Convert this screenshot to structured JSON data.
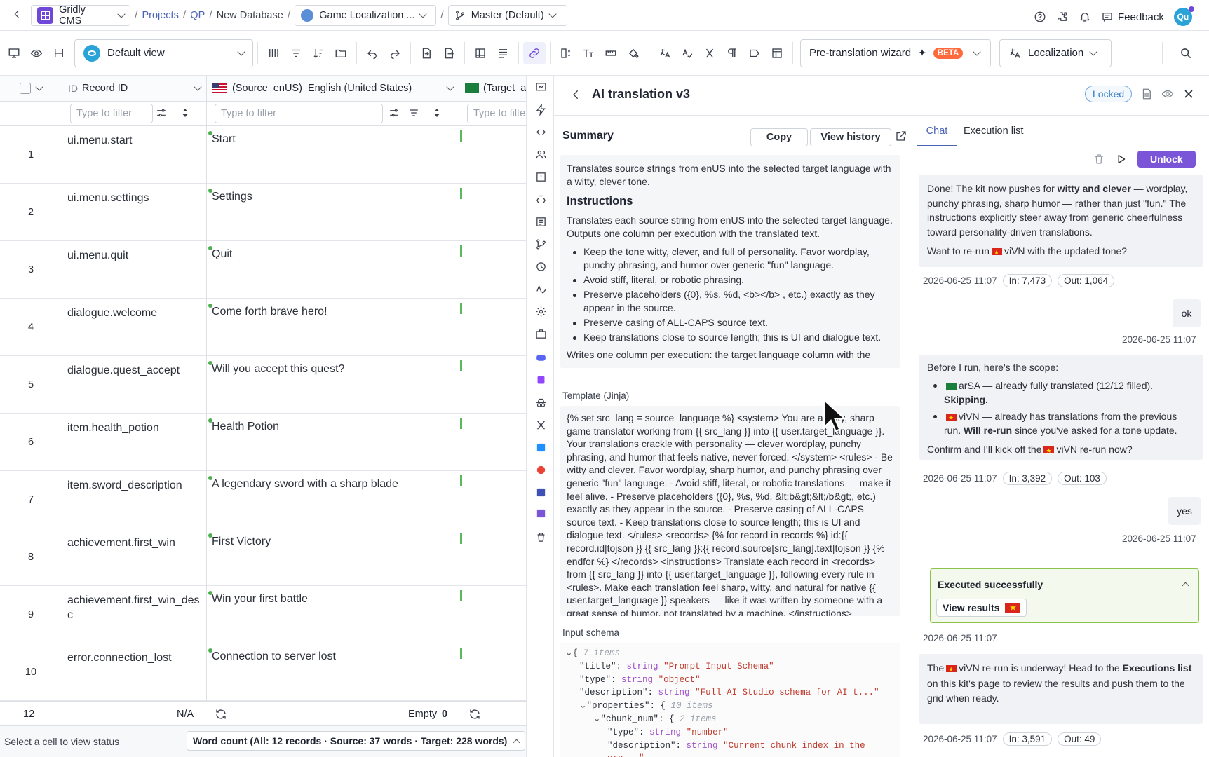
{
  "topbar": {
    "app_name": "Gridly CMS",
    "crumbs": [
      "Projects",
      "QP",
      "New Database"
    ],
    "grid_name": "Game Localization ...",
    "branch": "Master (Default)",
    "feedback": "Feedback",
    "avatar": "Qu"
  },
  "toolbar": {
    "view": "Default view",
    "pretranslation": "Pre-translation wizard",
    "beta": "BETA",
    "localization": "Localization"
  },
  "grid": {
    "col_id_prefix": "ID",
    "col_id": "Record ID",
    "col_src_code": "(Source_enUS)",
    "col_src_name": "English (United States)",
    "col_tgt": "(Target_a",
    "filter_placeholder": "Type to filter",
    "filter_placeholder_short": "Type to filte",
    "rows": [
      {
        "num": "1",
        "id": "ui.menu.start",
        "src": "Start"
      },
      {
        "num": "2",
        "id": "ui.menu.settings",
        "src": "Settings"
      },
      {
        "num": "3",
        "id": "ui.menu.quit",
        "src": "Quit"
      },
      {
        "num": "4",
        "id": "dialogue.welcome",
        "src": "Come forth brave hero!"
      },
      {
        "num": "5",
        "id": "dialogue.quest_accept",
        "src": "Will you accept this quest?"
      },
      {
        "num": "6",
        "id": "item.health_potion",
        "src": "Health Potion"
      },
      {
        "num": "7",
        "id": "item.sword_description",
        "src": "A legendary sword with a sharp blade"
      },
      {
        "num": "8",
        "id": "achievement.first_win",
        "src": "First Victory"
      },
      {
        "num": "9",
        "id": "achievement.first_win_desc",
        "src": "Win your first battle"
      },
      {
        "num": "10",
        "id": "error.connection_lost",
        "src": "Connection to server lost"
      }
    ],
    "footer_count": "12",
    "footer_na": "N/A",
    "footer_empty": "Empty",
    "footer_empty_count": "0",
    "status": "Select a cell to view status",
    "word_count": "Word count (All: 12 records · Source: 37 words · Target: 228 words)"
  },
  "panel": {
    "title": "AI translation v3",
    "locked": "Locked",
    "summary_label": "Summary",
    "copy": "Copy",
    "view_history": "View history",
    "summary_intro": "Translates source strings from enUS into the selected target language with a witty, clever tone.",
    "instructions_heading": "Instructions",
    "instructions_text": "Translates each source string from enUS into the selected target language. Outputs one column per execution with the translated text.",
    "bullets": [
      "Keep the tone witty, clever, and full of personality. Favor wordplay, punchy phrasing, and humor over generic \"fun\" language.",
      "Avoid stiff, literal, or robotic phrasing.",
      "Preserve placeholders ({0}, %s, %d, <b></b> , etc.) exactly as they appear in the source.",
      "Preserve casing of ALL-CAPS source text.",
      "Keep translations close to source length; this is UI and dialogue text."
    ],
    "summary_tail": "Writes one column per execution: the target language column with the",
    "template_label": "Template (Jinja)",
    "template_text": "{% set src_lang = source_language %} <system> You are a witty, sharp game translator working from {{ src_lang }} into {{ user.target_language }}. Your translations crackle with personality — clever wordplay, punchy phrasing, and humor that feels native, never forced. </system> <rules> - Be witty and clever. Favor wordplay, sharp humor, and punchy phrasing over generic \"fun\" language. - Avoid stiff, literal, or robotic translations — make it feel alive. - Preserve placeholders ({0}, %s, %d, &lt;b&gt;&lt;/b&gt;, etc.) exactly as they appear in the source. - Preserve casing of ALL-CAPS source text. - Keep translations close to source length; this is UI and dialogue text. </rules> <records> {% for record in records %} id:{{ record.id|tojson }} {{ src_lang }}:{{ record.source[src_lang].text|tojson }} {% endfor %} </records> <instructions> Translate each record in <records> from {{ src_lang }} into {{ user.target_language }}, following every rule in <rules>. Make each translation feel sharp, witty, and natural for native {{ user.target_language }} speakers — like it was written by someone with a great sense of humor, not translated by a machine. </instructions>",
    "schema_label": "Input schema",
    "schema": {
      "items_root": "7 items",
      "title_key": "\"title\"",
      "title_val": "\"Prompt Input Schema\"",
      "type_key": "\"type\"",
      "type_val": "\"object\"",
      "desc_key": "\"description\"",
      "desc_val": "\"Full AI Studio schema for AI t...\"",
      "props_key": "\"properties\"",
      "props_count": "10 items",
      "chunk_key": "\"chunk_num\"",
      "chunk_count": "2 items",
      "ctype_key": "\"type\"",
      "ctype_val": "\"number\"",
      "cdesc_key": "\"description\"",
      "cdesc_val": "\"Current chunk index in the pro...\"",
      "string_t": "string"
    }
  },
  "chat": {
    "tab_chat": "Chat",
    "tab_exec": "Execution list",
    "unlock": "Unlock",
    "msg1_a": "Done! The kit now pushes for ",
    "msg1_b": "witty and clever",
    "msg1_c": " — wordplay, punchy phrasing, sharp humor — rather than just \"fun.\" The instructions explicitly steer away from generic cheerfulness toward personality-driven translations.",
    "msg1_q_a": "Want to re-run",
    "msg1_q_b": "viVN with the updated tone?",
    "meta1_time": "2026-06-25 11:07",
    "meta1_in": "In: 7,473",
    "meta1_out": "Out: 1,064",
    "user1": "ok",
    "user1_time": "2026-06-25 11:07",
    "msg2_intro": "Before I run, here's the scope:",
    "msg2_b1_a": "arSA — already fully translated (12/12 filled).",
    "msg2_b1_b": "Skipping.",
    "msg2_b2_a": "viVN — already has translations from the previous run.",
    "msg2_b2_b": "Will re-run",
    "msg2_b2_c": " since you've asked for a tone update.",
    "msg2_q_a": "Confirm and I'll kick off the",
    "msg2_q_b": "viVN re-run now?",
    "meta2_time": "2026-06-25 11:07",
    "meta2_in": "In: 3,392",
    "meta2_out": "Out: 103",
    "user2": "yes",
    "user2_time": "2026-06-25 11:07",
    "exec_title": "Executed successfully",
    "view_results": "View results",
    "exec_time": "2026-06-25 11:07",
    "msg3_a": "The",
    "msg3_b": "viVN re-run is underway! Head to the ",
    "msg3_c": "Executions list",
    "msg3_d": " on this kit's page to review the results and push them to the grid when ready.",
    "meta3_time": "2026-06-25 11:07",
    "meta3_in": "In: 3,591",
    "meta3_out": "Out: 49"
  },
  "colors": {
    "accent": "#7a55d8",
    "brand": "#6f48d9",
    "success": "#5cb85c",
    "beta": "#ff6a3d",
    "link": "#4a63b5"
  }
}
